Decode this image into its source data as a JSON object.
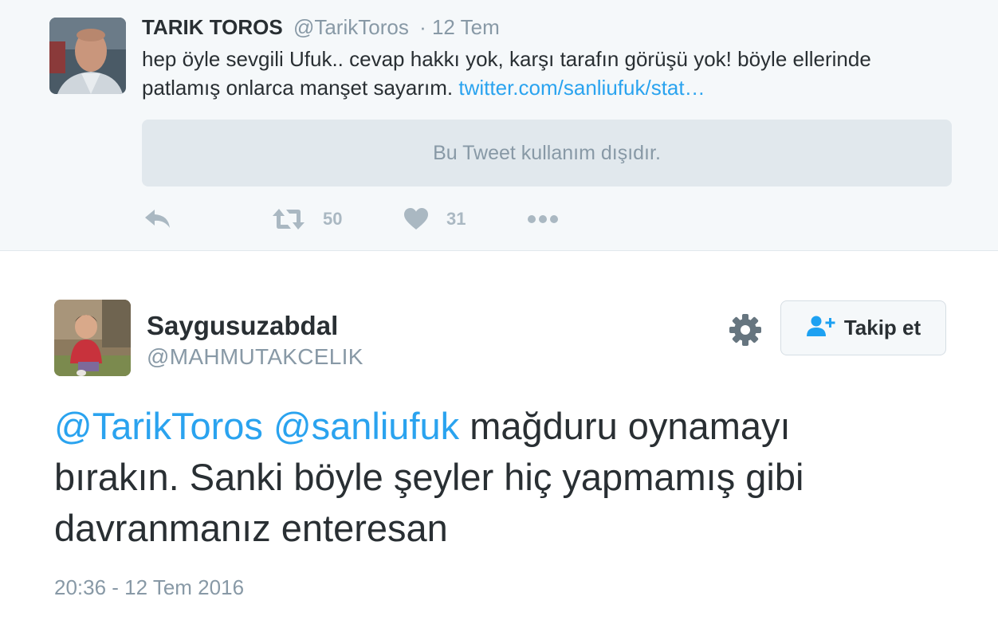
{
  "parent_tweet": {
    "author_name": "TARIK TOROS",
    "author_handle": "@TarikToros",
    "date": "· 12 Tem",
    "text_line1": "hep öyle sevgili Ufuk.. cevap hakkı yok, karşı tarafın görüşü yok! böyle ellerinde",
    "text_line2": "patlamış onlarca manşet sayarım.",
    "link_text": "twitter.com/sanliufuk/stat…",
    "withheld_notice": "Bu Tweet kullanım dışıdır.",
    "retweet_count": "50",
    "like_count": "31",
    "icons": {
      "reply": "reply-icon",
      "retweet": "retweet-icon",
      "like": "heart-icon",
      "more": "more-dots-icon"
    }
  },
  "tweet": {
    "author_name": "Saygusuzabdal",
    "author_handle": "@MAHMUTAKCELIK",
    "follow_label": "Takip et",
    "mention1": "@TarikToros",
    "mention2": "@sanliufuk",
    "text_line1_rest": " mağduru oynamayı",
    "text_line2": "bırakın. Sanki böyle şeyler hiç yapmamış gibi",
    "text_line3": "davranmanız enteresan",
    "timestamp": "20:36 - 12 Tem 2016",
    "icons": {
      "settings": "gear-icon",
      "follow": "add-user-icon"
    }
  },
  "colors": {
    "link": "#2aa3ef",
    "muted": "#8899a6",
    "action_icons": "#aab8c2",
    "text": "#292f33",
    "parent_background": "#f5f8fa"
  }
}
